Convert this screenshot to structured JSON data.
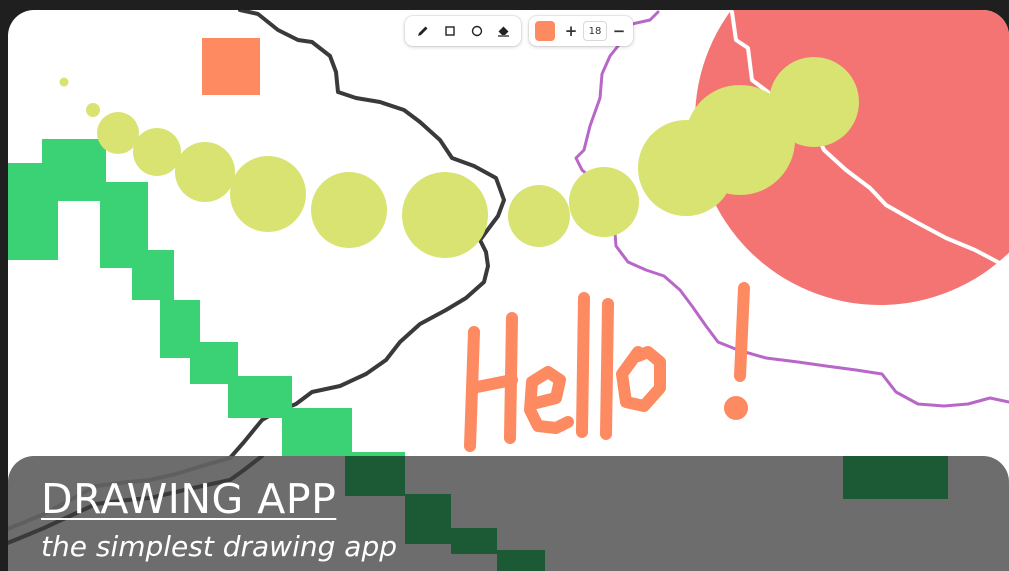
{
  "app": {
    "title": "DRAWING APP",
    "subtitle": "the simplest drawing app"
  },
  "toolbar": {
    "tools": [
      {
        "name": "pencil",
        "icon": "pencil-icon"
      },
      {
        "name": "rectangle",
        "icon": "square-icon"
      },
      {
        "name": "circle",
        "icon": "circle-icon"
      },
      {
        "name": "eraser",
        "icon": "eraser-icon"
      }
    ],
    "current_color": "#fd8a60",
    "increase_label": "+",
    "decrease_label": "−",
    "brush_size": "18"
  },
  "canvas": {
    "text_drawn": "Hello!",
    "colors": {
      "background": "#ffffff",
      "orange": "#fd8a60",
      "green": "#3bd276",
      "dark_green": "#1b5a34",
      "lime": "#d9e372",
      "red": "#f47474",
      "purple": "#b866c8",
      "dark_stroke": "#3a3a3a"
    }
  }
}
